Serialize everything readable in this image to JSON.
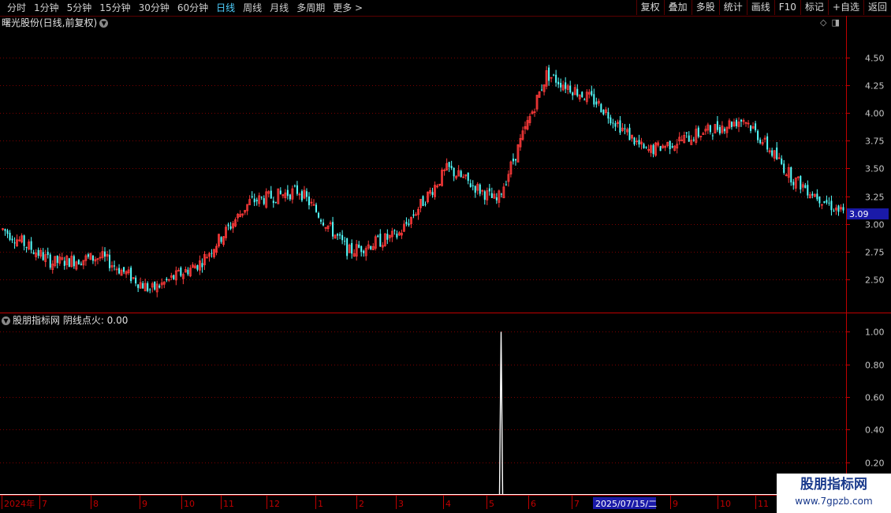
{
  "toolbar": {
    "periods": [
      "分时",
      "1分钟",
      "5分钟",
      "15分钟",
      "30分钟",
      "60分钟",
      "日线",
      "周线",
      "月线",
      "多周期",
      "更多 >"
    ],
    "active_period": "日线",
    "right_buttons": [
      "复权",
      "叠加",
      "多股",
      "统计",
      "画线",
      "F10",
      "标记",
      "+自选",
      "返回"
    ]
  },
  "price_panel": {
    "title": "曙光股份(日线,前复权)",
    "current_price": "3.09",
    "y_ticks": [
      "4.50",
      "4.25",
      "4.00",
      "3.75",
      "3.50",
      "3.25",
      "3.00",
      "2.75",
      "2.50"
    ]
  },
  "indicator_panel": {
    "title": "股朋指标网  阴线点火: 0.00",
    "y_ticks": [
      "1.00",
      "0.80",
      "0.60",
      "0.40",
      "0.20"
    ]
  },
  "x_axis": {
    "labels": [
      "2024年",
      "7",
      "8",
      "9",
      "10",
      "11",
      "12",
      "1",
      "2",
      "3",
      "4",
      "5",
      "6",
      "7",
      "9",
      "10",
      "11"
    ],
    "cursor_date": "2025/07/15/二"
  },
  "logo": {
    "line1": "股朋指标网",
    "line2": "www.7gpzb.com"
  },
  "colors": {
    "up": "#ff3a3a",
    "down": "#54ffff",
    "grid": "#7a0000",
    "axis": "#c00000",
    "cursor_bg": "#1a1aa8",
    "signal": "#ffffff"
  },
  "chart_data": [
    {
      "type": "candlestick",
      "title": "曙光股份(日线,前复权)",
      "ylim": [
        2.2,
        4.75
      ],
      "approx_close_path": [
        {
          "x": "2024-06",
          "y": 2.95
        },
        {
          "x": "2024-07",
          "y": 2.65
        },
        {
          "x": "2024-08",
          "y": 2.7
        },
        {
          "x": "2024-09",
          "y": 2.4
        },
        {
          "x": "2024-10",
          "y": 2.65
        },
        {
          "x": "2024-11",
          "y": 3.2
        },
        {
          "x": "2024-12",
          "y": 3.3
        },
        {
          "x": "2025-01",
          "y": 2.75
        },
        {
          "x": "2025-02",
          "y": 2.9
        },
        {
          "x": "2025-03",
          "y": 3.5
        },
        {
          "x": "2025-04",
          "y": 3.2
        },
        {
          "x": "2025-05",
          "y": 4.35
        },
        {
          "x": "2025-06",
          "y": 4.1
        },
        {
          "x": "2025-07",
          "y": 3.65
        },
        {
          "x": "2025-09",
          "y": 3.8
        },
        {
          "x": "2025-10",
          "y": 3.95
        },
        {
          "x": "2025-11",
          "y": 3.4
        },
        {
          "x": "2025-12",
          "y": 3.09
        }
      ]
    },
    {
      "type": "line",
      "title": "阴线点火",
      "ylim": [
        0,
        1.05
      ],
      "signal": {
        "date_label": "5",
        "value": 1.0
      }
    }
  ]
}
